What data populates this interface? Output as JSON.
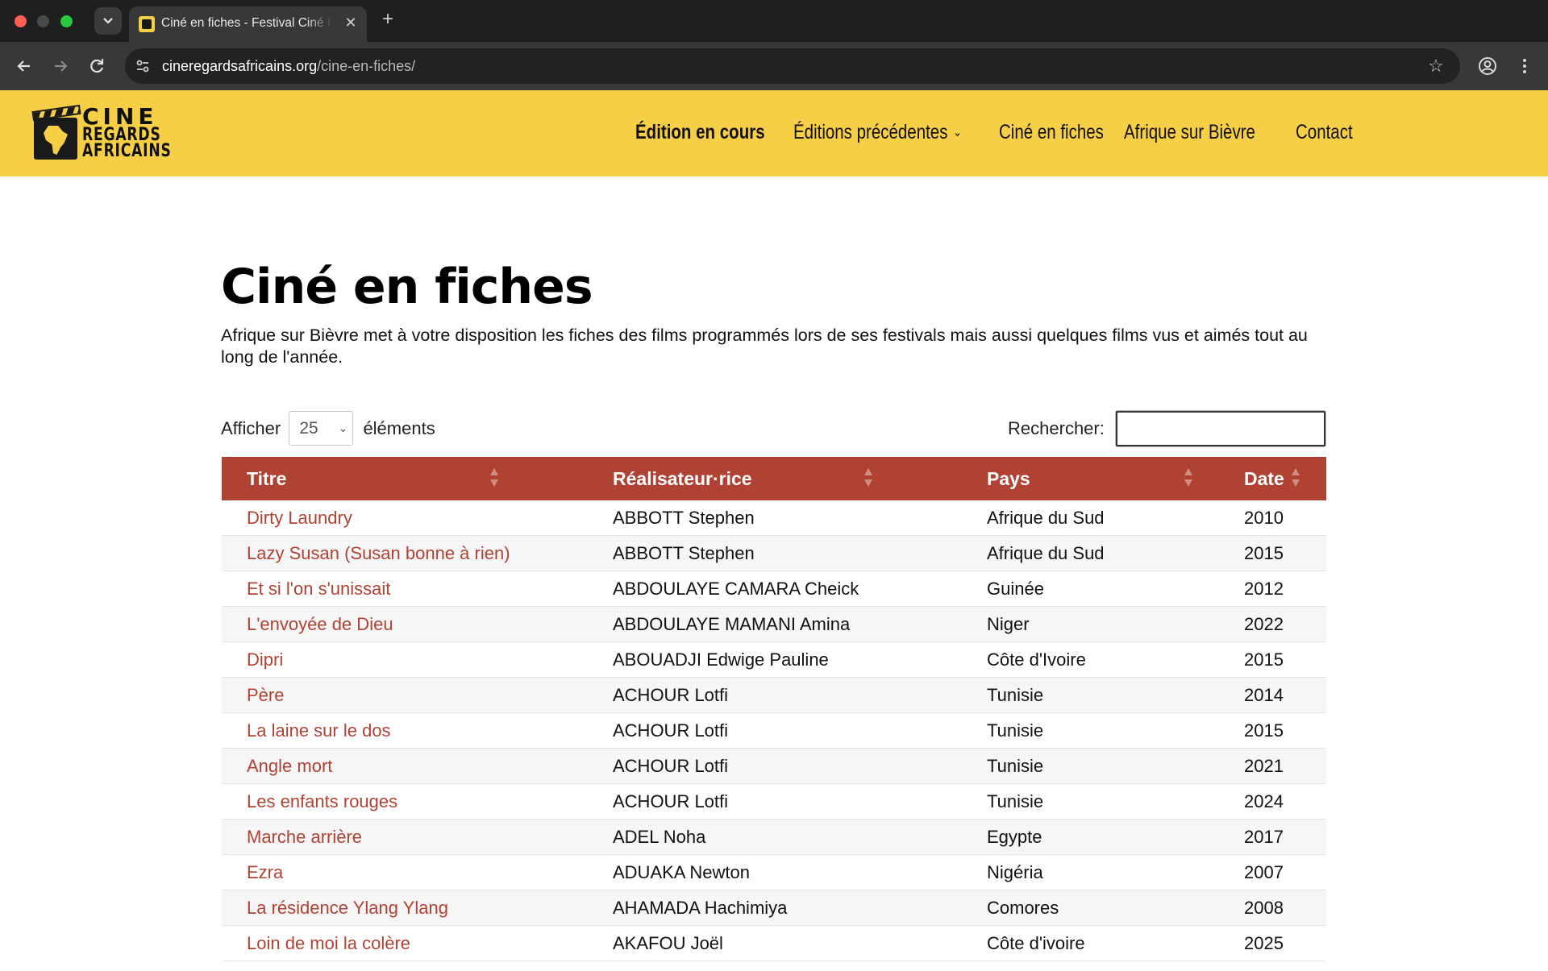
{
  "browser": {
    "tab_title": "Ciné en fiches - Festival Ciné Regards Africains",
    "url_host": "cineregardsafricains.org",
    "url_path": "/cine-en-fiches/"
  },
  "site": {
    "logo_lines": [
      "CINE",
      "REGARDS",
      "AFRICAINS"
    ],
    "nav": [
      {
        "label": "Édition en cours"
      },
      {
        "label": "Éditions précédentes"
      },
      {
        "label": "Ciné en fiches"
      },
      {
        "label": "Afrique sur Bièvre"
      },
      {
        "label": "Contact"
      }
    ]
  },
  "page": {
    "title": "Ciné en fiches",
    "intro": "Afrique sur Bièvre met à votre disposition les fiches des films programmés lors de ses festivals mais aussi quelques films vus et aimés tout au long de l'année."
  },
  "datatable": {
    "length_label_before": "Afficher",
    "length_value": "25",
    "length_label_after": "éléments",
    "search_label": "Rechercher:",
    "search_value": "",
    "columns": [
      "Titre",
      "Réalisateur·rice",
      "Pays",
      "Date"
    ],
    "rows": [
      [
        "Dirty Laundry",
        "ABBOTT Stephen",
        "Afrique du Sud",
        "2010"
      ],
      [
        "Lazy Susan (Susan bonne à rien)",
        "ABBOTT Stephen",
        "Afrique du Sud",
        "2015"
      ],
      [
        "Et si l'on s'unissait",
        "ABDOULAYE CAMARA Cheick",
        "Guinée",
        "2012"
      ],
      [
        "L'envoyée de Dieu",
        "ABDOULAYE MAMANI Amina",
        "Niger",
        "2022"
      ],
      [
        "Dipri",
        "ABOUADJI Edwige Pauline",
        "Côte d'Ivoire",
        "2015"
      ],
      [
        "Père",
        "ACHOUR Lotfi",
        "Tunisie",
        "2014"
      ],
      [
        "La laine sur le dos",
        "ACHOUR Lotfi",
        "Tunisie",
        "2015"
      ],
      [
        "Angle mort",
        "ACHOUR Lotfi",
        "Tunisie",
        "2021"
      ],
      [
        "Les enfants rouges",
        "ACHOUR Lotfi",
        "Tunisie",
        "2024"
      ],
      [
        "Marche arrière",
        "ADEL Noha",
        "Egypte",
        "2017"
      ],
      [
        "Ezra",
        "ADUAKA Newton",
        "Nigéria",
        "2007"
      ],
      [
        "La résidence Ylang Ylang",
        "AHAMADA Hachimiya",
        "Comores",
        "2008"
      ],
      [
        "Loin de moi la colère",
        "AKAFOU Joël",
        "Côte d'ivoire",
        "2025"
      ]
    ]
  },
  "colors": {
    "brand_yellow": "#f7cf46",
    "table_header": "#b04234",
    "link": "#b04234"
  }
}
